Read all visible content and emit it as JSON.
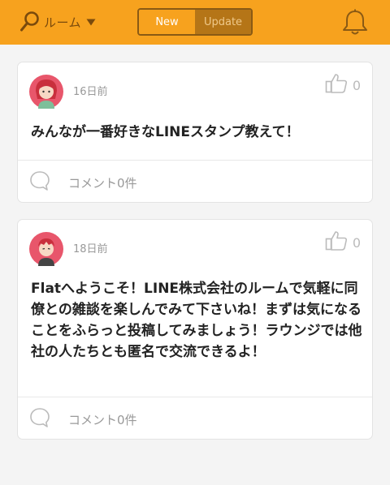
{
  "header": {
    "room_label": "ルーム",
    "icons": {
      "search": "search-icon",
      "caret": "caret-down-icon",
      "bell": "bell-icon"
    },
    "tabs": [
      {
        "label": "New",
        "active": true
      },
      {
        "label": "Update",
        "active": false
      }
    ]
  },
  "colors": {
    "header_bg": "#f7a21e",
    "tab_active_bg": "#f7a21e",
    "tab_inactive_bg": "#b57517",
    "avatar_bg": "#e8566b"
  },
  "posts": [
    {
      "timestamp": "16日前",
      "like_count": "0",
      "body": "みんなが一番好きなLINEスタンプ教えて！",
      "comment_label": "コメント0件",
      "avatar": "girl-avatar"
    },
    {
      "timestamp": "18日前",
      "like_count": "0",
      "body": "Flatへようこそ！LINE株式会社のルームで気軽に同僚との雑談を楽しんでみて下さいね！まずは気になることをふらっと投稿してみましょう！ラウンジでは他社の人たちとも匿名で交流できるよ！",
      "comment_label": "コメント0件",
      "avatar": "boy-avatar"
    }
  ]
}
